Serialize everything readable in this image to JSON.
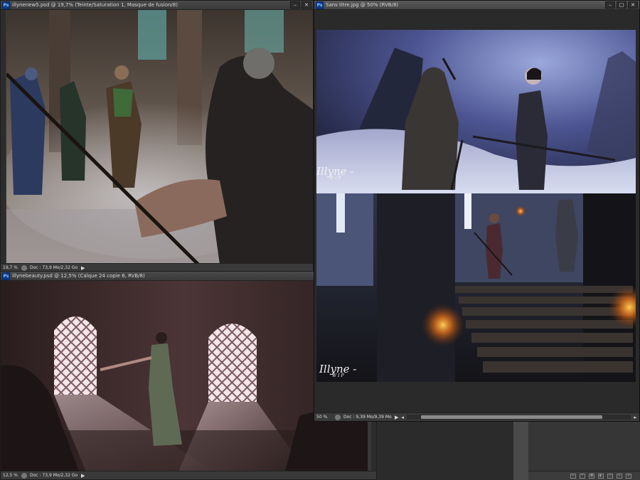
{
  "windows": {
    "top_left": {
      "title": "illynenew5.psd @ 19,7% (Teinte/Saturation 1, Masque de fusion/8)",
      "zoom": "19,7 %",
      "doc": "Doc : 73,9 Mo/2,32 Go"
    },
    "bottom_left": {
      "title": "illynebeauty.psd @ 12,5% (Calque 24 copie 6, RVB/8)",
      "zoom": "12,5 %",
      "doc": "Doc : 73,9 Mo/2,32 Go"
    },
    "right": {
      "title": "Sans titre.jpg @ 50% (RVB/8)",
      "zoom": "50 %",
      "doc": "Doc : 9,39 Mo/9,39 Mo",
      "buttons": {
        "minimize": "–",
        "maximize": "□",
        "close": "✕"
      },
      "signature_top": "Illyne -",
      "signature_top_sub": "WIP",
      "signature_bottom": "Illyne -",
      "signature_bottom_sub": "WIP"
    }
  },
  "colors": {
    "workspace": "#4a4a4a",
    "window_bg": "#383838",
    "titlebar": "#4a4a4a",
    "ps_icon": "#0b3b8c"
  }
}
